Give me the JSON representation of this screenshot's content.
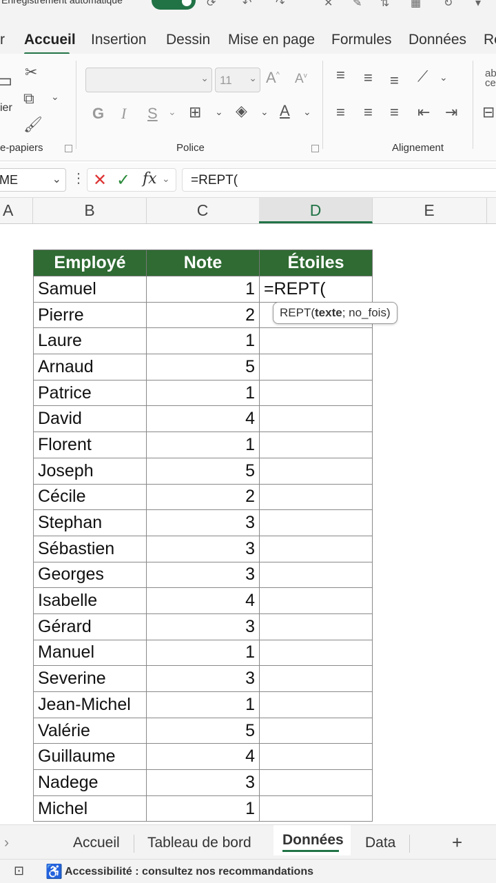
{
  "titlebar": {
    "title": "Enregistrement automatique"
  },
  "tabs": [
    {
      "label": "r"
    },
    {
      "label": "Accueil"
    },
    {
      "label": "Insertion"
    },
    {
      "label": "Dessin"
    },
    {
      "label": "Mise en page"
    },
    {
      "label": "Formules"
    },
    {
      "label": "Données"
    },
    {
      "label": "Ré"
    }
  ],
  "ribbon": {
    "clipboard": {
      "label": "e-papiers",
      "paste_label": "ier"
    },
    "font": {
      "label": "Police",
      "font_name": "",
      "font_size": "11"
    },
    "alignment": {
      "label": "Alignement"
    },
    "wrap_fragment": "ab\nce"
  },
  "formula_bar": {
    "name_box": "ME",
    "formula": "=REPT("
  },
  "columns": [
    "A",
    "B",
    "C",
    "D",
    "E"
  ],
  "table": {
    "headers": [
      "Employé",
      "Note",
      "Étoiles"
    ],
    "rows": [
      {
        "name": "Samuel",
        "note": "1",
        "stars": "=REPT("
      },
      {
        "name": "Pierre",
        "note": "2",
        "stars": ""
      },
      {
        "name": "Laure",
        "note": "1",
        "stars": ""
      },
      {
        "name": "Arnaud",
        "note": "5",
        "stars": ""
      },
      {
        "name": "Patrice",
        "note": "1",
        "stars": ""
      },
      {
        "name": "David",
        "note": "4",
        "stars": ""
      },
      {
        "name": "Florent",
        "note": "1",
        "stars": ""
      },
      {
        "name": "Joseph",
        "note": "5",
        "stars": ""
      },
      {
        "name": "Cécile",
        "note": "2",
        "stars": ""
      },
      {
        "name": "Stephan",
        "note": "3",
        "stars": ""
      },
      {
        "name": "Sébastien",
        "note": "3",
        "stars": ""
      },
      {
        "name": "Georges",
        "note": "3",
        "stars": ""
      },
      {
        "name": "Isabelle",
        "note": "4",
        "stars": ""
      },
      {
        "name": "Gérard",
        "note": "3",
        "stars": ""
      },
      {
        "name": "Manuel",
        "note": "1",
        "stars": ""
      },
      {
        "name": "Severine",
        "note": "3",
        "stars": ""
      },
      {
        "name": "Jean-Michel",
        "note": "1",
        "stars": ""
      },
      {
        "name": "Valérie",
        "note": "5",
        "stars": ""
      },
      {
        "name": "Guillaume",
        "note": "4",
        "stars": ""
      },
      {
        "name": "Nadege",
        "note": "3",
        "stars": ""
      },
      {
        "name": "Michel",
        "note": "1",
        "stars": ""
      }
    ]
  },
  "tooltip": {
    "func": "REPT(",
    "arg1": "texte",
    "rest": "; no_fois)"
  },
  "sheet_tabs": [
    {
      "label": "Accueil"
    },
    {
      "label": "Tableau de bord"
    },
    {
      "label": "Données"
    },
    {
      "label": "Data"
    }
  ],
  "status": {
    "accessibility": "Accessibilité : consultez nos recommandations"
  },
  "colors": {
    "accent": "#217346",
    "header_fill": "#2f6b33"
  }
}
